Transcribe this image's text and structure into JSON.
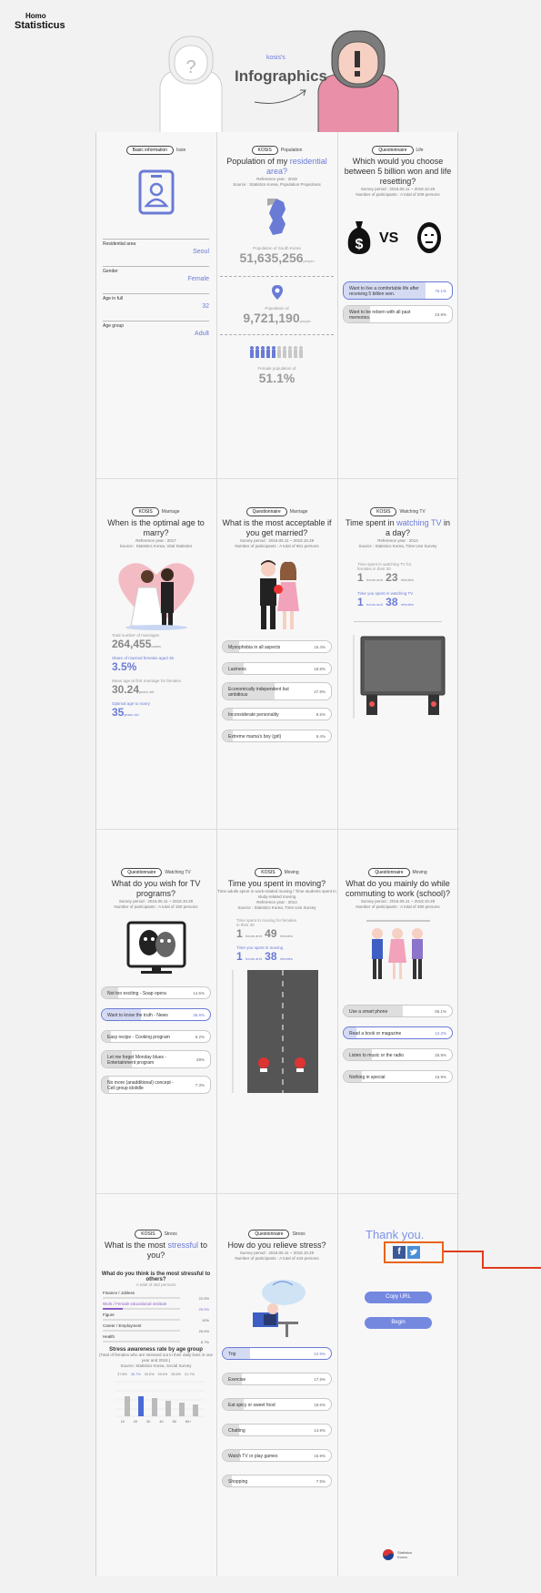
{
  "brand": {
    "line1": "Homo",
    "line2": "Statisticus"
  },
  "hero": {
    "kicker": "kosis's",
    "title": "Infographics"
  },
  "basic": {
    "tag": "Basic information",
    "tag_label": "Issie",
    "rows": [
      {
        "label": "Residential area",
        "value": "Seoul"
      },
      {
        "label": "Gender",
        "value": "Female"
      },
      {
        "label": "Age in full",
        "value": "32"
      },
      {
        "label": "Age group",
        "value": "Adult"
      }
    ]
  },
  "population": {
    "tag": "KOSIS",
    "tag_label": "Population",
    "title_a": "Population of my ",
    "title_b": "residential area?",
    "ref": "Reference year : 2018",
    "src": "Source : Statistics Korea, Population Projections",
    "s1_label": "Population of South Korea",
    "s1_value": "51,635,256",
    "s1_unit": "people",
    "s2_label": "Population of",
    "s2_value": "9,721,190",
    "s2_unit": "people",
    "s3_label": "Female population of",
    "s3_value": "51.1%"
  },
  "life": {
    "tag": "Questionnaire",
    "tag_label": "Life",
    "title": "Which would you choose between 5 billion won and life resetting?",
    "period": "Survey period : 2016.05.11 ~ 2018.10.29",
    "participants": "Number of participants : A total of 209 persons",
    "vs": "VS",
    "options": [
      {
        "label": "Want to live a comfortable life after receiving 5 billion won.",
        "pct": "76.1%"
      },
      {
        "label": "Want to be reborn with all past memories.",
        "pct": "23.9%"
      }
    ]
  },
  "marriage": {
    "tag": "KOSIS",
    "tag_label": "Marriage",
    "title": "When is the optimal age to marry?",
    "ref": "Reference year : 2017",
    "src": "Source : Statistics Korea, Vital Statistics",
    "l1": "Total number of marriages",
    "v1": "264,455",
    "u1": "cases",
    "l2": "Share of married females aged 35",
    "v2": "3.5%",
    "l3": "Mean age at first marriage for females",
    "v3": "30.24",
    "u3": "years old",
    "l4": "Optimal age to marry",
    "v4": "35",
    "u4": "years old"
  },
  "married_if": {
    "tag": "Questionnaire",
    "tag_label": "Marriage",
    "title": "What is the most acceptable if you get married?",
    "period": "Survey period : 2016.05.11 ~ 2018.10.29",
    "participants": "Number of participants : A total of 651 persons",
    "options": [
      {
        "label": "Mysophobia in all aspects",
        "pct": "15.4%"
      },
      {
        "label": "Laziness",
        "pct": "18.8%"
      },
      {
        "label": "Economically independent but ambitious",
        "pct": "47.8%"
      },
      {
        "label": "Inconsiderate personality",
        "pct": "8.5%"
      },
      {
        "label": "Extreme mama's boy (girl)",
        "pct": "9.4%"
      }
    ]
  },
  "tv": {
    "tag": "KOSIS",
    "tag_label": "Watching TV",
    "title_a": "Time spent in ",
    "title_b": "watching TV",
    "title_c": " in a day?",
    "ref": "Reference year : 2014",
    "src": "Source : Statistics Korea, Time Use Survey",
    "a_label": "Time spent in watching TV for females in their 30",
    "a_h": "1",
    "a_m": "23",
    "b_label": "Time you spent in watching TV",
    "b_h": "1",
    "b_m": "38",
    "hours": "hours and",
    "minutes": "minutes"
  },
  "tv_wish": {
    "tag": "Questionnaire",
    "tag_label": "Watching TV",
    "title": "What do you wish for TV programs?",
    "period": "Survey period : 2016.05.11 ~ 2018.10.29",
    "participants": "Number of participants : A total of 150 persons",
    "options": [
      {
        "label": "Not too exciting - Soap opera",
        "pct": "14.5%"
      },
      {
        "label": "Want to know the truth - News",
        "pct": "35.8%"
      },
      {
        "label": "Easy recipe - Cooking program",
        "pct": "8.2%"
      },
      {
        "label": "Let me forget Monday blues - Entertainment program",
        "pct": "28%"
      },
      {
        "label": "No more (anadditional) concept - Cell group idolidle",
        "pct": "7.3%"
      }
    ]
  },
  "moving": {
    "tag": "KOSIS",
    "tag_label": "Moving",
    "title": "Time you spent in moving?",
    "sub": "Time adults spent in work-related moving / Time students spent in study-related moving",
    "ref": "Reference year : 2014",
    "src": "Source : Statistics Korea, Time Use Survey",
    "a_label": "Time spent in moving for females in their 30",
    "a_h": "1",
    "a_m": "49",
    "b_label": "Time you spent in moving",
    "b_h": "1",
    "b_m": "38",
    "hours": "hours and",
    "minutes": "minutes"
  },
  "commute": {
    "tag": "Questionnaire",
    "tag_label": "Moving",
    "title": "What do you mainly do while commuting to work (school)?",
    "period": "Survey period : 2016.05.11 ~ 2018.10.29",
    "participants": "Number of participants : A total of 480 persons",
    "options": [
      {
        "label": "Use a smart phone",
        "pct": "55.1%"
      },
      {
        "label": "Read a book or magazine",
        "pct": "12.2%"
      },
      {
        "label": "Listen to music or the radio",
        "pct": "25.9%"
      },
      {
        "label": "Nothing in special",
        "pct": "16.9%"
      }
    ]
  },
  "stress": {
    "tag": "KOSIS",
    "tag_label": "Stress",
    "title_a": "What is the most ",
    "title_b": "stressful",
    "title_c": " to you?",
    "q": "What do you think is the most stressful to others?",
    "count": "A total of 462 persons",
    "items": [
      {
        "label": "Finance / Jobless",
        "pct": "22.5%"
      },
      {
        "label": "Work / Female educational institute",
        "pct": "25.9%"
      },
      {
        "label": "Figure",
        "pct": "10%"
      },
      {
        "label": "Career / Employment",
        "pct": "25.9%"
      },
      {
        "label": "Health",
        "pct": "6.7%"
      }
    ],
    "sub": "Stress awareness rate by age group",
    "sub2": "(Total of females who are stressed out in their daily lives in one year and 2018.)",
    "sub3": "Source: Statistics Korea, Social Survey",
    "ages": [
      "10",
      "20",
      "30",
      "40",
      "50",
      "60+"
    ],
    "age_vals": [
      "37.8%",
      "36.7%",
      "33.0%",
      "29.0%",
      "25.6%",
      "21.7%"
    ]
  },
  "relieve": {
    "tag": "Questionnaire",
    "tag_label": "Stress",
    "title": "How do you relieve stress?",
    "period": "Survey period : 2016.05.11 ~ 2018.10.29",
    "participants": "Number of participants : A total of 443 persons",
    "options": [
      {
        "label": "Trip",
        "pct": "24.9%"
      },
      {
        "label": "Exercise",
        "pct": "17.5%"
      },
      {
        "label": "Eat spicy or sweet food",
        "pct": "18.6%"
      },
      {
        "label": "Chatting",
        "pct": "14.9%"
      },
      {
        "label": "Watch TV or play games",
        "pct": "15.9%"
      },
      {
        "label": "Shopping",
        "pct": "7.5%"
      }
    ]
  },
  "end": {
    "thanks": "Thank you.",
    "copy": "Copy URL",
    "begin": "Begin",
    "footer": "Statistics Korea"
  }
}
